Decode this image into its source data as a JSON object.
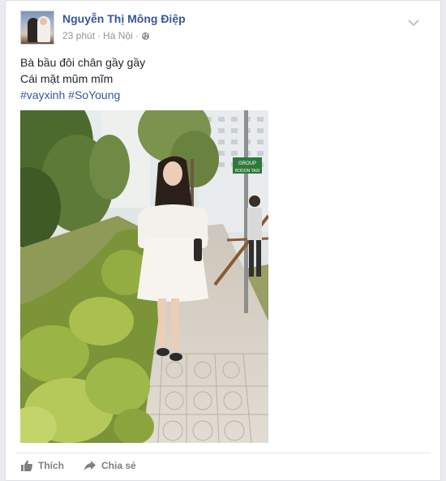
{
  "post": {
    "author_name": "Nguyễn Thị Mông Điệp",
    "time": "23 phút",
    "separator": "·",
    "location": "Hà Nội",
    "separator2": "·",
    "privacy_icon": "globe-icon",
    "options_icon": "chevron-down-icon",
    "text_line1": "Bà bầu đôi chân gầy gầy",
    "text_line2": "Cái mặt mũm mĩm",
    "hashtags": [
      "#vayxinh",
      "#SoYoung"
    ],
    "photo": {
      "sign_top": "GROUP",
      "sign_bottom": "RODON TAXI"
    }
  },
  "actions": {
    "like_label": "Thích",
    "like_icon": "thumbs-up-icon",
    "share_label": "Chia sẻ",
    "share_icon": "share-arrow-icon"
  },
  "colors": {
    "link": "#365899",
    "meta": "#90949c",
    "text": "#1d2129",
    "action": "#7f7f7f"
  }
}
